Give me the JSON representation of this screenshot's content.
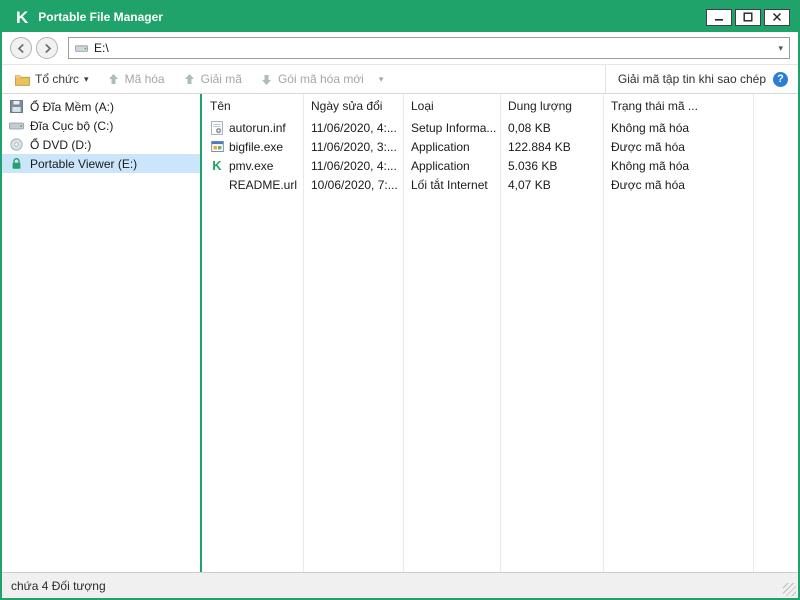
{
  "window": {
    "title": "Portable File Manager",
    "logo_glyph": "K"
  },
  "address_bar": {
    "value": "E:\\",
    "dropdown_glyph": "▾"
  },
  "toolbar": {
    "organize": "Tổ chức",
    "encrypt": "Mã hóa",
    "decrypt": "Giải mã",
    "new_package": "Gói mã hóa mới",
    "dropdown_glyph": "▾",
    "right_label": "Giải mã tập tin khi sao chép",
    "help_glyph": "?"
  },
  "sidebar": {
    "items": [
      {
        "label": "Ổ Đĩa Mềm (A:)",
        "icon": "floppy-drive-icon",
        "selected": false
      },
      {
        "label": "Đĩa Cục bộ (C:)",
        "icon": "local-disk-icon",
        "selected": false
      },
      {
        "label": "Ổ DVD (D:)",
        "icon": "dvd-drive-icon",
        "selected": false
      },
      {
        "label": "Portable Viewer (E:)",
        "icon": "protected-drive-icon",
        "selected": true
      }
    ]
  },
  "file_list": {
    "columns": [
      "Tên",
      "Ngày sửa đổi",
      "Loại",
      "Dung lượng",
      "Trạng thái mã ..."
    ],
    "rows": [
      {
        "icon": "setup-file-icon",
        "name": "autorun.inf",
        "modified": "11/06/2020, 4:...",
        "type": "Setup Informa...",
        "size": "0,08 KB",
        "status": "Không mã hóa"
      },
      {
        "icon": "application-icon",
        "name": "bigfile.exe",
        "modified": "11/06/2020, 3:...",
        "type": "Application",
        "size": "122.884 KB",
        "status": "Được mã hóa"
      },
      {
        "icon": "kaspersky-app-icon",
        "name": "pmv.exe",
        "modified": "11/06/2020, 4:...",
        "type": "Application",
        "size": "5.036 KB",
        "status": "Không mã hóa"
      },
      {
        "icon": "none",
        "name": "README.url",
        "modified": "10/06/2020, 7:...",
        "type": "Lối tắt Internet",
        "size": "4,07 KB",
        "status": "Được mã hóa"
      }
    ]
  },
  "icons": {
    "kaspersky_glyph": "K"
  },
  "status_bar": {
    "text": "chứa 4 Đối tượng"
  },
  "colors": {
    "brand_green": "#20a26b",
    "selected_item_bg": "#cbe6fb",
    "disabled_text": "#a6a6a6",
    "help_blue": "#2d7dd2"
  }
}
